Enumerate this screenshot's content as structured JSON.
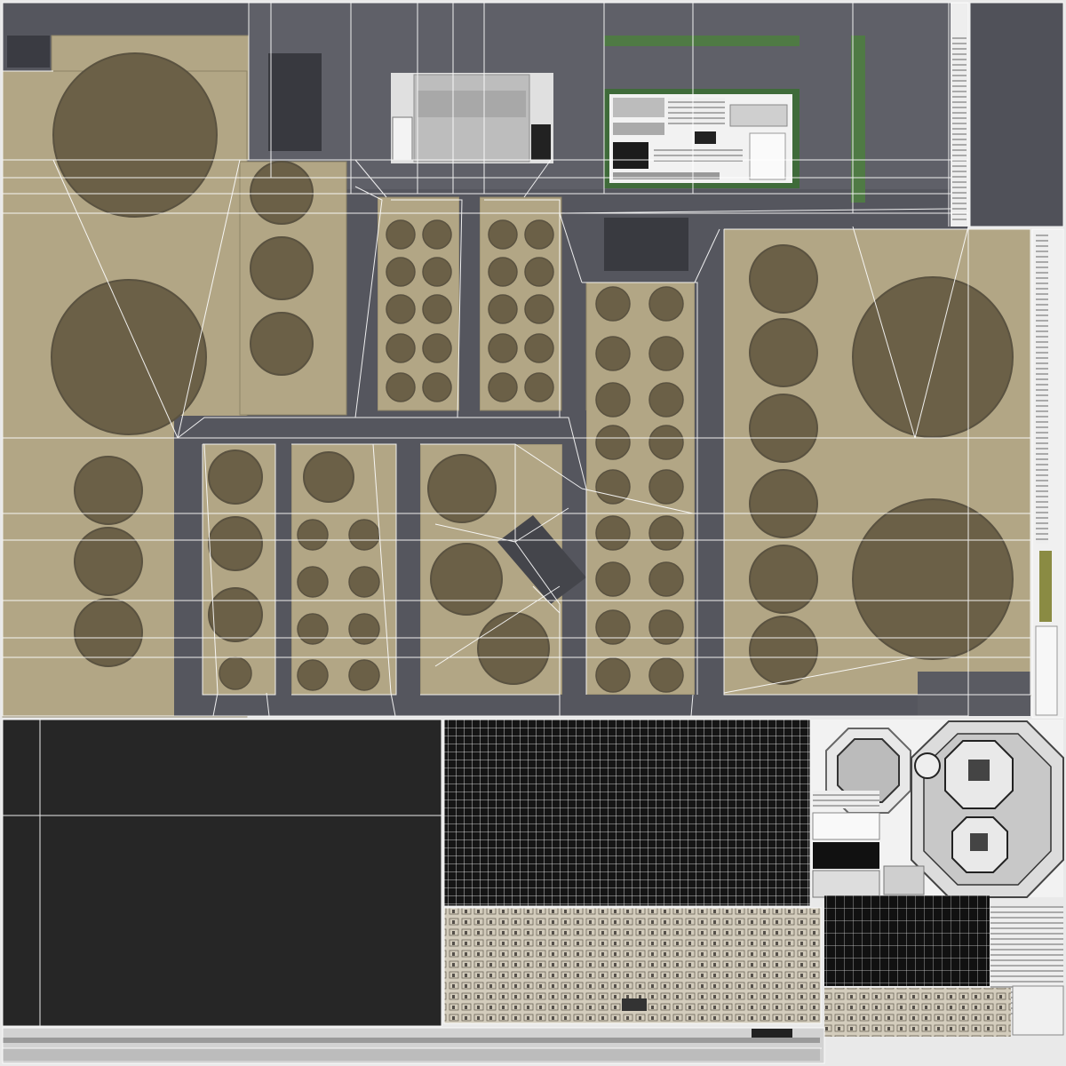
{
  "colors": {
    "background": "#e9e9e9",
    "asphalt": "#55565e",
    "asphalt_light": "#6d6e77",
    "sand": "#b5a886",
    "sand_dark": "#a59a78",
    "tank": "#6c6148",
    "tank_dark": "#5c5340",
    "grass": "#4f7a44",
    "panel_dark": "#262626",
    "facade": "#cfc7b6",
    "wire": "#ffffff"
  },
  "regions": {
    "terrain": "terrain-atlas",
    "roof_panel": "dark-roof-panel",
    "glass_grid": "glass-grid-panel",
    "facade": "building-facade-panel",
    "roofs": "round-roof-tiles"
  }
}
